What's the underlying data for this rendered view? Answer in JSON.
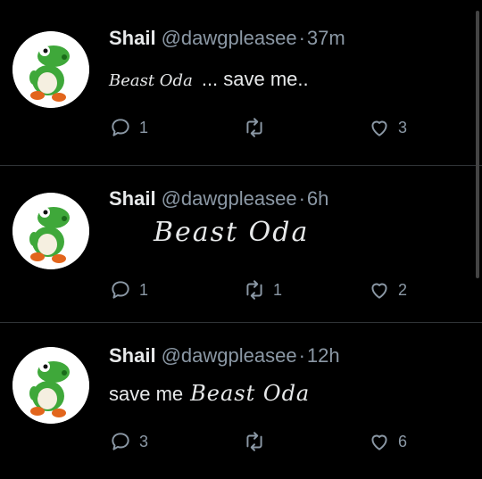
{
  "tweets": [
    {
      "name": "Shail",
      "handle": "@dawgpleasee",
      "time": "37m",
      "annotation": "Beast Oda",
      "text": "... save me..",
      "reply_count": "1",
      "retweet_count": "",
      "like_count": "3"
    },
    {
      "name": "Shail",
      "handle": "@dawgpleasee",
      "time": "6h",
      "annotation": "Beast Oda",
      "text": "",
      "reply_count": "1",
      "retweet_count": "1",
      "like_count": "2"
    },
    {
      "name": "Shail",
      "handle": "@dawgpleasee",
      "time": "12h",
      "text": "save me",
      "annotation": "Beast Oda",
      "reply_count": "3",
      "retweet_count": "",
      "like_count": "6"
    }
  ],
  "icons": {
    "avatar": "yoshi-avatar",
    "reply": "reply-icon",
    "retweet": "retweet-icon",
    "like": "heart-icon"
  },
  "colors": {
    "background": "#000000",
    "text": "#e7e9ea",
    "muted": "#8b98a5",
    "divider": "#2f3336"
  }
}
